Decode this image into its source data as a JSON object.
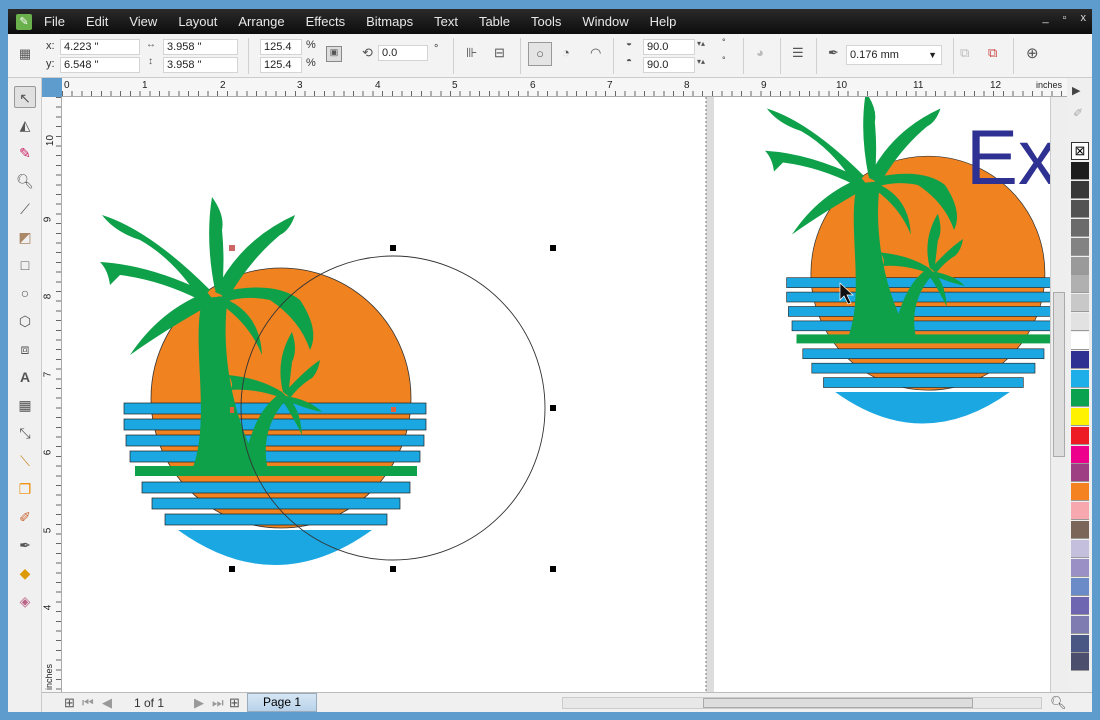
{
  "menu": [
    "File",
    "Edit",
    "View",
    "Layout",
    "Arrange",
    "Effects",
    "Bitmaps",
    "Text",
    "Table",
    "Tools",
    "Window",
    "Help"
  ],
  "window_controls": [
    "_",
    "▫",
    "x"
  ],
  "propbar": {
    "x_label": "x:",
    "x": "4.223 \"",
    "y_label": "y:",
    "y": "6.548 \"",
    "w": "3.958 \"",
    "h": "3.958 \"",
    "scale_x": "125.4",
    "scale_y": "125.4",
    "pct": "%",
    "angle": "0.0",
    "deg": "°",
    "start_angle": "90.0",
    "end_angle": "90.0",
    "outline_width": "0.176 mm"
  },
  "ruler": {
    "top": [
      "0",
      "1",
      "2",
      "3",
      "4",
      "5",
      "6",
      "7",
      "8",
      "9",
      "10",
      "11",
      "12"
    ],
    "unit": "inches",
    "left": [
      "10",
      "9",
      "8",
      "7",
      "6",
      "5",
      "4"
    ],
    "left_unit": "inches"
  },
  "tools": [
    "pick",
    "shape",
    "smudge",
    "zoom",
    "freehand",
    "smart-fill",
    "rectangle",
    "ellipse",
    "polygon",
    "basic-shapes",
    "text",
    "table",
    "dimension",
    "connector",
    "blend",
    "eyedropper",
    "outline",
    "fill",
    "interactive-fill"
  ],
  "palette": [
    "#1c1c1c",
    "#383838",
    "#535353",
    "#6b6b6b",
    "#838383",
    "#9a9a9a",
    "#b0b0b0",
    "#c8c8c8",
    "#e2e2e2",
    "#ffffff",
    "#2e3192",
    "#1eaee8",
    "#0aa24f",
    "#fff200",
    "#ed1c24",
    "#ec008c",
    "#9e3f84",
    "#f58220",
    "#f7a8ae",
    "#7a6558",
    "#c4bfdd",
    "#9b90c6",
    "#6a8bc8",
    "#6e66b0",
    "#7f7cb2",
    "#4a5683",
    "#4b4f6d"
  ],
  "colors": {
    "orange": "#f08220",
    "blue": "#1ba8e2",
    "green": "#0fa04a",
    "text": "#2e3192"
  },
  "art_text": "Ex",
  "bottombar": {
    "page_count": "1 of 1",
    "page_tab": "Page 1"
  }
}
